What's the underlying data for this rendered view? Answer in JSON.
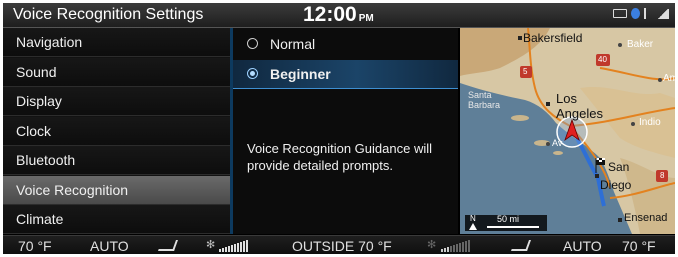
{
  "header": {
    "title": "Voice Recognition Settings",
    "time": "12:00",
    "ampm": "PM"
  },
  "menu": {
    "items": [
      {
        "label": "Navigation"
      },
      {
        "label": "Sound"
      },
      {
        "label": "Display"
      },
      {
        "label": "Clock"
      },
      {
        "label": "Bluetooth"
      },
      {
        "label": "Voice Recognition",
        "selected": true
      },
      {
        "label": "Climate"
      }
    ]
  },
  "options": {
    "items": [
      {
        "label": "Normal",
        "selected": false
      },
      {
        "label": "Beginner",
        "selected": true
      }
    ],
    "description": "Voice Recognition Guidance will provide detailed prompts."
  },
  "map": {
    "labels": {
      "bakersfield": "Bakersfield",
      "baker": "Baker",
      "amb": "Amb",
      "santa_barbara_1": "Santa",
      "santa_barbara_2": "Barbara",
      "los": "Los",
      "angeles": "Angeles",
      "indio": "Indio",
      "avalon": "Av",
      "san": "San",
      "diego": "Diego",
      "ensenada": "Ensenad"
    },
    "shields": {
      "i5": "5",
      "i40": "40",
      "i8": "8"
    },
    "scale": {
      "north": "N",
      "distance": "50 mi"
    }
  },
  "climate": {
    "left_temp": "70 °F",
    "left_mode": "AUTO",
    "outside": "OUTSIDE 70 °F",
    "right_mode": "AUTO",
    "right_temp": "70 °F",
    "left_fan_level": 1.0,
    "right_fan_level": 0.3
  },
  "colors": {
    "accent_blue": "#1b4468",
    "selected_row": "#5a5a5a",
    "route": "#2e6fd6",
    "position_arrow": "#e02020"
  }
}
